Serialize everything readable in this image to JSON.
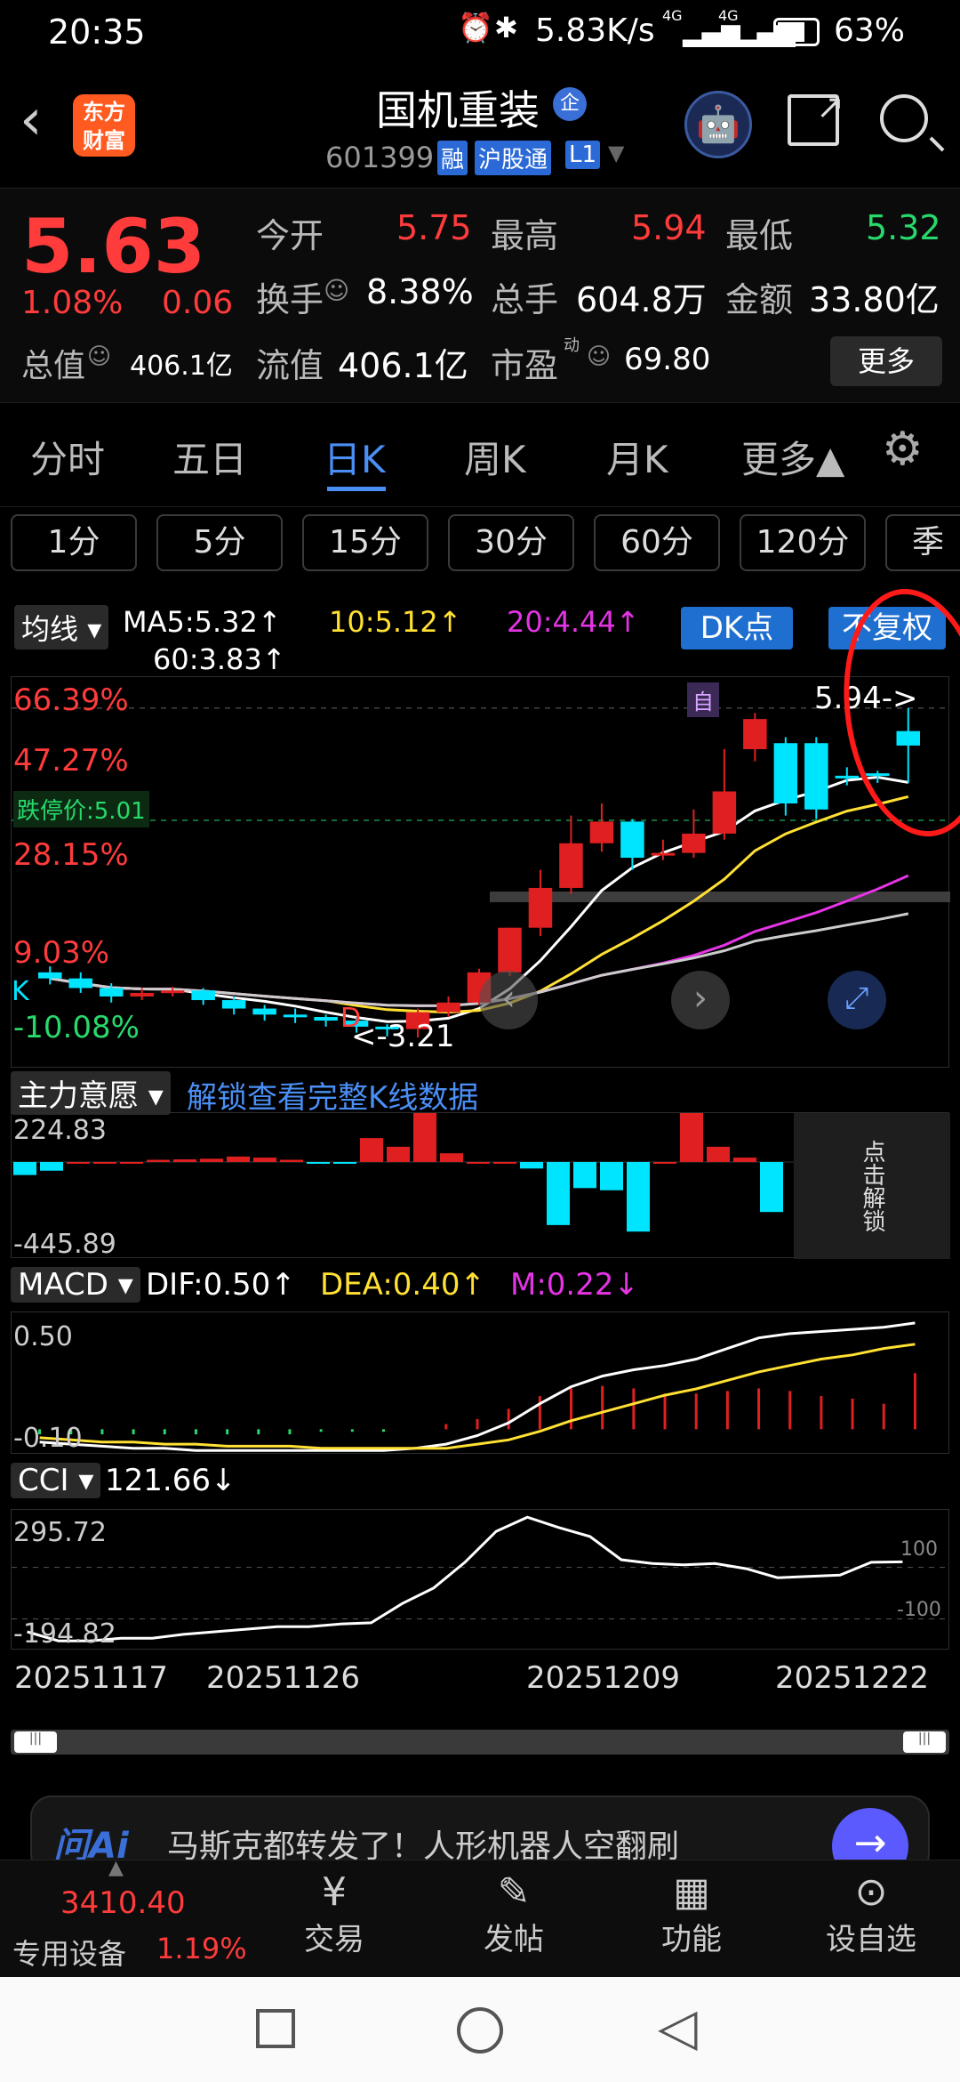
{
  "statusbar": {
    "time": "20:35",
    "speed": "5.83K/s",
    "signal1": "4G",
    "signal2": "4G",
    "battery": "63%"
  },
  "header": {
    "logo": "东方财富",
    "title": "国机重装",
    "title_badge": "企",
    "code": "601399",
    "badges": [
      "融",
      "沪股通",
      "L1"
    ]
  },
  "quote": {
    "price": "5.63",
    "change_pct": "1.08%",
    "change": "0.06",
    "fields": [
      {
        "label": "今开",
        "value": "5.75"
      },
      {
        "label": "最高",
        "value": "5.94"
      },
      {
        "label": "最低",
        "value": "5.32"
      },
      {
        "label": "换手",
        "value": "8.38%"
      },
      {
        "label": "总手",
        "value": "604.8万"
      },
      {
        "label": "金额",
        "value": "33.80亿"
      },
      {
        "label": "总值",
        "value": "406.1亿"
      },
      {
        "label": "流值",
        "value": "406.1亿"
      },
      {
        "label": "市盈",
        "value": "69.80",
        "sup": "动"
      }
    ],
    "more": "更多"
  },
  "tabs": [
    "分时",
    "五日",
    "日K",
    "周K",
    "月K",
    "更多▲"
  ],
  "intervals": [
    "1分",
    "5分",
    "15分",
    "30分",
    "60分",
    "120分",
    "季"
  ],
  "kline": {
    "ma_dropdown": "均线",
    "ma5": "MA5:5.32↑",
    "ma10": "10:5.12↑",
    "ma20": "20:4.44↑",
    "ma60": "60:3.83↑",
    "dk_button": "DK点",
    "fq_button": "不复权",
    "y_labels": [
      "66.39%",
      "47.27%",
      "28.15%",
      "9.03%",
      "-10.08%"
    ],
    "limit_label": "跌停价:5.01",
    "high_marker": "5.94->",
    "low_marker": "<-3.21",
    "zi_badge": "自",
    "k_label": "K",
    "d_label": "D"
  },
  "chart_data": [
    {
      "type": "candlestick",
      "title": "日K",
      "dates_shown": [
        "20251117",
        "20251126",
        "20251209",
        "20251222"
      ],
      "candles": [
        {
          "open": 3.75,
          "close": 3.7,
          "high": 3.8,
          "low": 3.65
        },
        {
          "open": 3.7,
          "close": 3.62,
          "high": 3.75,
          "low": 3.58
        },
        {
          "open": 3.62,
          "close": 3.55,
          "high": 3.66,
          "low": 3.5
        },
        {
          "open": 3.55,
          "close": 3.58,
          "high": 3.62,
          "low": 3.52
        },
        {
          "open": 3.58,
          "close": 3.6,
          "high": 3.63,
          "low": 3.55
        },
        {
          "open": 3.6,
          "close": 3.52,
          "high": 3.62,
          "low": 3.48
        },
        {
          "open": 3.52,
          "close": 3.45,
          "high": 3.55,
          "low": 3.4
        },
        {
          "open": 3.45,
          "close": 3.4,
          "high": 3.48,
          "low": 3.35
        },
        {
          "open": 3.4,
          "close": 3.38,
          "high": 3.45,
          "low": 3.33
        },
        {
          "open": 3.38,
          "close": 3.35,
          "high": 3.4,
          "low": 3.3
        },
        {
          "open": 3.35,
          "close": 3.3,
          "high": 3.38,
          "low": 3.25
        },
        {
          "open": 3.3,
          "close": 3.28,
          "high": 3.32,
          "low": 3.22
        },
        {
          "open": 3.28,
          "close": 3.42,
          "high": 3.45,
          "low": 3.21
        },
        {
          "open": 3.42,
          "close": 3.5,
          "high": 3.55,
          "low": 3.38
        },
        {
          "open": 3.5,
          "close": 3.75,
          "high": 3.78,
          "low": 3.48
        },
        {
          "open": 3.75,
          "close": 4.12,
          "high": 4.12,
          "low": 3.72
        },
        {
          "open": 4.12,
          "close": 4.45,
          "high": 4.6,
          "low": 4.05
        },
        {
          "open": 4.45,
          "close": 4.82,
          "high": 5.05,
          "low": 4.4
        },
        {
          "open": 4.82,
          "close": 5.0,
          "high": 5.15,
          "low": 4.75
        },
        {
          "open": 5.0,
          "close": 4.7,
          "high": 5.02,
          "low": 4.6
        },
        {
          "open": 4.72,
          "close": 4.74,
          "high": 4.85,
          "low": 4.68
        },
        {
          "open": 4.74,
          "close": 4.9,
          "high": 5.1,
          "low": 4.7
        },
        {
          "open": 4.9,
          "close": 5.25,
          "high": 5.6,
          "low": 4.85
        },
        {
          "open": 5.6,
          "close": 5.85,
          "high": 5.9,
          "low": 5.5
        },
        {
          "open": 5.65,
          "close": 5.15,
          "high": 5.7,
          "low": 5.05
        },
        {
          "open": 5.65,
          "close": 5.1,
          "high": 5.7,
          "low": 5.02
        },
        {
          "open": 5.38,
          "close": 5.36,
          "high": 5.45,
          "low": 5.3
        },
        {
          "open": 5.4,
          "close": 5.38,
          "high": 5.42,
          "low": 5.32
        },
        {
          "open": 5.75,
          "close": 5.63,
          "high": 5.94,
          "low": 5.32
        }
      ],
      "ma": [
        {
          "name": "MA5",
          "color": "#ffffff"
        },
        {
          "name": "MA10",
          "color": "#ffe033"
        },
        {
          "name": "MA20",
          "color": "#e534e5"
        },
        {
          "name": "MA60",
          "color": "#cccccc"
        }
      ]
    },
    {
      "type": "bar",
      "title": "主力意愿",
      "ylim": [
        -445.89,
        224.83
      ],
      "values": [
        -60,
        -40,
        0,
        0,
        0,
        10,
        12,
        15,
        25,
        20,
        10,
        -8,
        -6,
        110,
        70,
        224.83,
        40,
        0,
        0,
        -30,
        -290,
        -120,
        -130,
        -320,
        0,
        224.83,
        70,
        20,
        -230
      ],
      "colors": {
        "up": "#e02020",
        "down": "#00e5ff"
      }
    },
    {
      "type": "bar",
      "title": "MACD",
      "labels": [
        "DIF:0.50↑",
        "DEA:0.40↑",
        "M:0.22↓"
      ],
      "ylim": [
        -0.12,
        0.55
      ],
      "y_labels": [
        "0.50",
        "-0.10"
      ],
      "dif": [
        -0.06,
        -0.07,
        -0.08,
        -0.09,
        -0.09,
        -0.1,
        -0.1,
        -0.1,
        -0.1,
        -0.1,
        -0.1,
        -0.1,
        -0.09,
        -0.07,
        -0.03,
        0.03,
        0.12,
        0.2,
        0.25,
        0.28,
        0.3,
        0.33,
        0.38,
        0.43,
        0.45,
        0.46,
        0.47,
        0.48,
        0.5
      ],
      "dea": [
        -0.04,
        -0.05,
        -0.06,
        -0.06,
        -0.07,
        -0.07,
        -0.08,
        -0.08,
        -0.08,
        -0.09,
        -0.09,
        -0.09,
        -0.09,
        -0.09,
        -0.07,
        -0.05,
        -0.01,
        0.04,
        0.08,
        0.12,
        0.16,
        0.19,
        0.23,
        0.27,
        0.3,
        0.33,
        0.35,
        0.38,
        0.4
      ],
      "m": [
        -0.02,
        -0.02,
        -0.02,
        -0.02,
        -0.02,
        -0.02,
        -0.02,
        -0.02,
        -0.02,
        -0.01,
        -0.01,
        -0.01,
        0.0,
        0.02,
        0.04,
        0.08,
        0.13,
        0.16,
        0.17,
        0.16,
        0.14,
        0.14,
        0.15,
        0.16,
        0.15,
        0.13,
        0.12,
        0.1,
        0.22
      ]
    },
    {
      "type": "line",
      "title": "CCI",
      "label": "121.66↓",
      "y_labels": [
        "295.72",
        "-194.82"
      ],
      "ref_labels": [
        "100",
        "-100"
      ],
      "ylim": [
        -194.82,
        295.72
      ],
      "values": [
        -150,
        -185,
        -185,
        -175,
        -175,
        -160,
        -150,
        -140,
        -130,
        -130,
        -120,
        -115,
        -40,
        20,
        120,
        240,
        295,
        255,
        220,
        130,
        115,
        110,
        115,
        95,
        60,
        65,
        70,
        120,
        121.66
      ]
    }
  ],
  "zhuli": {
    "dropdown": "主力意愿",
    "unlock": "解锁查看完整K线数据",
    "y_top": "224.83",
    "y_bottom": "-445.89",
    "side_unlock": "点击解锁"
  },
  "macd": {
    "dropdown": "MACD",
    "dif": "DIF:0.50↑",
    "dea": "DEA:0.40↑",
    "m": "M:0.22↓",
    "y_top": "0.50",
    "y_bottom": "-0.10"
  },
  "cci": {
    "dropdown": "CCI",
    "value": "121.66↓",
    "y_top": "295.72",
    "y_bottom": "-194.82",
    "ref_top": "100",
    "ref_bottom": "-100"
  },
  "dates": [
    "20251117",
    "20251126",
    "20251209",
    "20251222"
  ],
  "banner": {
    "logo": "问Ai",
    "text": "马斯克都转发了！人形机器人空翻刷"
  },
  "bottomnav": {
    "index_value": "3410.40",
    "sector": "专用设备",
    "sector_pct": "1.19%",
    "items": [
      "交易",
      "发帖",
      "功能",
      "设自选"
    ]
  },
  "colors": {
    "up": "#e02020",
    "down": "#00e5ff",
    "accent": "#4a8ff5",
    "brand": "#ff5a1f"
  }
}
